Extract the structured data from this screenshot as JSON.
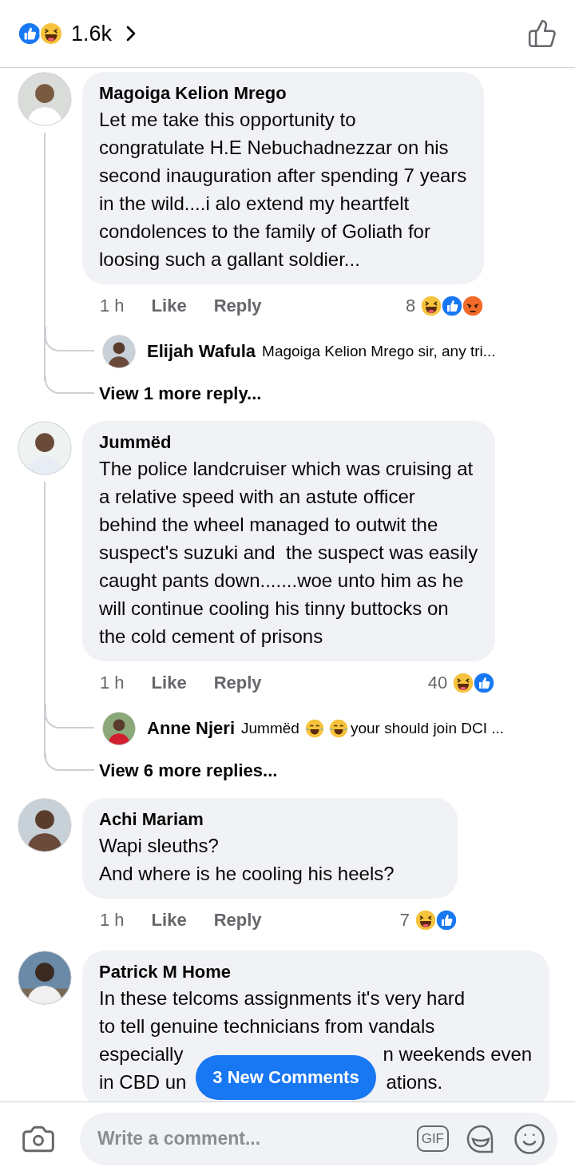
{
  "header": {
    "reactions": [
      {
        "kind": "like"
      },
      {
        "kind": "haha"
      }
    ],
    "count": "1.6k"
  },
  "comments": [
    {
      "author": "Magoiga Kelion Mrego",
      "lines": [
        {
          "text": "Let me take this opportunity to"
        },
        {
          "text": "congratulate H.E Nebuchadnezzar on his"
        },
        {
          "text": "second inauguration after spending 7 years"
        },
        {
          "text": "in the wild....i alo extend my heartfelt"
        },
        {
          "text": "condolences to the family of Goliath for"
        },
        {
          "text": "loosing such a gallant soldier..."
        }
      ],
      "time": "1 h",
      "like": "Like",
      "reply": "Reply",
      "reaction_count": "8",
      "reactions": [
        {
          "kind": "haha"
        },
        {
          "kind": "like"
        },
        {
          "kind": "angry"
        }
      ],
      "replies": [
        {
          "author": "Elijah Wafula",
          "parts": [
            {
              "kind": "text",
              "text": "Magoiga Kelion Mrego sir, any tri..."
            }
          ]
        }
      ],
      "more_replies": "View 1 more reply..."
    },
    {
      "author": "Jummëd",
      "lines": [
        {
          "text": "The police landcruiser which was cruising at"
        },
        {
          "text": "a relative speed with an astute officer"
        },
        {
          "text": "behind the wheel managed to outwit the"
        },
        {
          "text": "suspect's suzuki and  the suspect was easily"
        },
        {
          "text": "caught pants down.......woe unto him as he"
        },
        {
          "text": "will continue cooling his tinny buttocks on"
        },
        {
          "text": "the cold cement of prisons"
        }
      ],
      "time": "1 h",
      "like": "Like",
      "reply": "Reply",
      "reaction_count": "40",
      "reactions": [
        {
          "kind": "haha"
        },
        {
          "kind": "like"
        }
      ],
      "replies": [
        {
          "author": "Anne Njeri",
          "parts": [
            {
              "kind": "text",
              "text": "Jummëd"
            },
            {
              "kind": "emoji"
            },
            {
              "kind": "emoji"
            },
            {
              "kind": "text",
              "text": "your should join DCI ..."
            }
          ]
        }
      ],
      "more_replies": "View 6 more replies..."
    },
    {
      "author": "Achi Mariam",
      "lines": [
        {
          "text": "Wapi sleuths?"
        },
        {
          "text": "And where is he cooling his heels?"
        }
      ],
      "time": "1 h",
      "like": "Like",
      "reply": "Reply",
      "reaction_count": "7",
      "reactions": [
        {
          "kind": "haha"
        },
        {
          "kind": "like"
        }
      ]
    },
    {
      "author": "Patrick M Home",
      "lines": [
        {
          "text": "In these telcoms assignments it's very hard"
        },
        {
          "text": "to tell genuine technicians from vandals"
        },
        {
          "text": "especially",
          "after_cover": "n weekends even"
        },
        {
          "text": "in CBD un",
          "after_cover": "ations."
        }
      ]
    }
  ],
  "new_comments": "3 New Comments",
  "composer": {
    "placeholder": "Write a comment...",
    "gif_label": "GIF"
  }
}
